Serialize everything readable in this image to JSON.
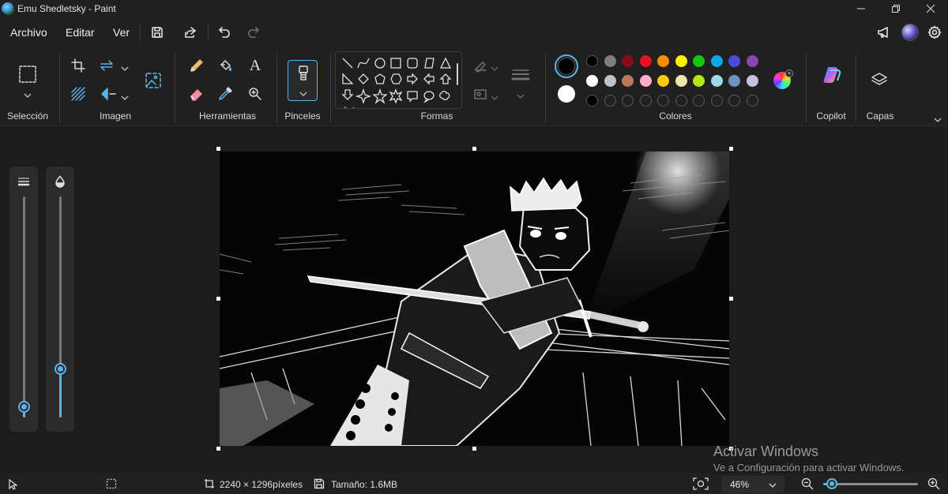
{
  "titlebar": {
    "title": "Emu Shedletsky - Paint"
  },
  "menu": {
    "file": "Archivo",
    "edit": "Editar",
    "view": "Ver"
  },
  "ribbon": {
    "selection_label": "Selección",
    "image_label": "Imagen",
    "tools_label": "Herramientas",
    "brushes_label": "Pinceles",
    "shapes_label": "Formas",
    "colors_label": "Colores",
    "copilot_label": "Copilot",
    "layers_label": "Capas",
    "text_tool_glyph": "A"
  },
  "colors": {
    "primary": "#000000",
    "secondary": "#ffffff",
    "accent": "#5db3e8",
    "palette_row1": [
      "#000000",
      "#7f7f7f",
      "#8b0a1a",
      "#e81123",
      "#ff8c00",
      "#fff100",
      "#16c60c",
      "#0ea5e9",
      "#4a4adb",
      "#8e44ad"
    ],
    "palette_row2": [
      "#ffffff",
      "#c3c3c3",
      "#b97a57",
      "#ffaec9",
      "#ffc90e",
      "#efe4b0",
      "#b5e61d",
      "#99d9ea",
      "#7092be",
      "#c8bfe7"
    ]
  },
  "status": {
    "dimensions": "2240 × 1296píxeles",
    "size": "Tamaño: 1.6MB",
    "zoom": "46%",
    "zoom_fraction": 0.07
  },
  "watermark": {
    "title": "Activar Windows",
    "subtitle": "Ve a Configuración para activar Windows."
  },
  "sliders": {
    "size_level": 0.05,
    "opacity_level": 0.22
  }
}
